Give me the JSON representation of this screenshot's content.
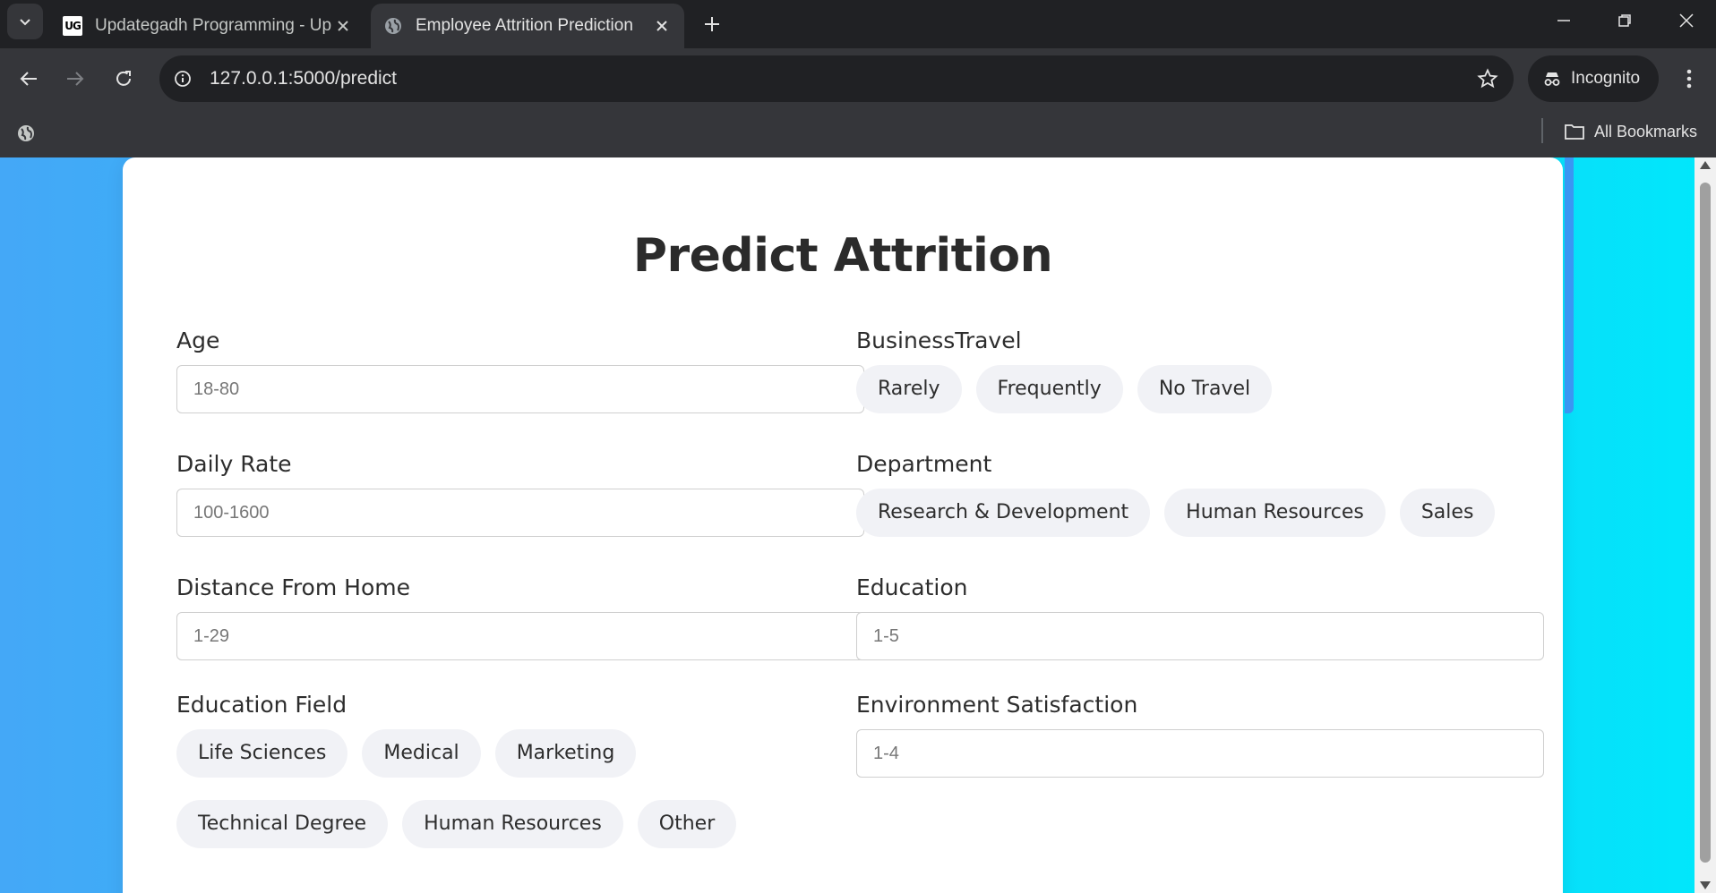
{
  "browser": {
    "tabs": [
      {
        "title": "Updategadh Programming - Up",
        "favicon": "ug-logo-icon",
        "active": false
      },
      {
        "title": "Employee Attrition Prediction",
        "favicon": "globe-icon",
        "active": true
      }
    ],
    "url": "127.0.0.1:5000/predict",
    "incognito_label": "Incognito",
    "bookmarks_label": "All Bookmarks",
    "favicon_text": "UG"
  },
  "form": {
    "title": "Predict Attrition",
    "age": {
      "label": "Age",
      "placeholder": "18-80"
    },
    "daily_rate": {
      "label": "Daily Rate",
      "placeholder": "100-1600"
    },
    "distance_from_home": {
      "label": "Distance From Home",
      "placeholder": "1-29"
    },
    "education": {
      "label": "Education",
      "placeholder": "1-5"
    },
    "environment_satisfaction": {
      "label": "Environment Satisfaction",
      "placeholder": "1-4"
    },
    "business_travel": {
      "label": "BusinessTravel",
      "options": [
        "Rarely",
        "Frequently",
        "No Travel"
      ]
    },
    "department": {
      "label": "Department",
      "options": [
        "Research & Development",
        "Human Resources",
        "Sales"
      ]
    },
    "education_field": {
      "label": "Education Field",
      "options": [
        "Life Sciences",
        "Medical",
        "Marketing",
        "Technical Degree",
        "Human Resources",
        "Other"
      ]
    }
  },
  "colors": {
    "gradient_start": "#44a8f7",
    "gradient_end": "#00e8fb",
    "chip_bg": "#f1f2f6"
  }
}
